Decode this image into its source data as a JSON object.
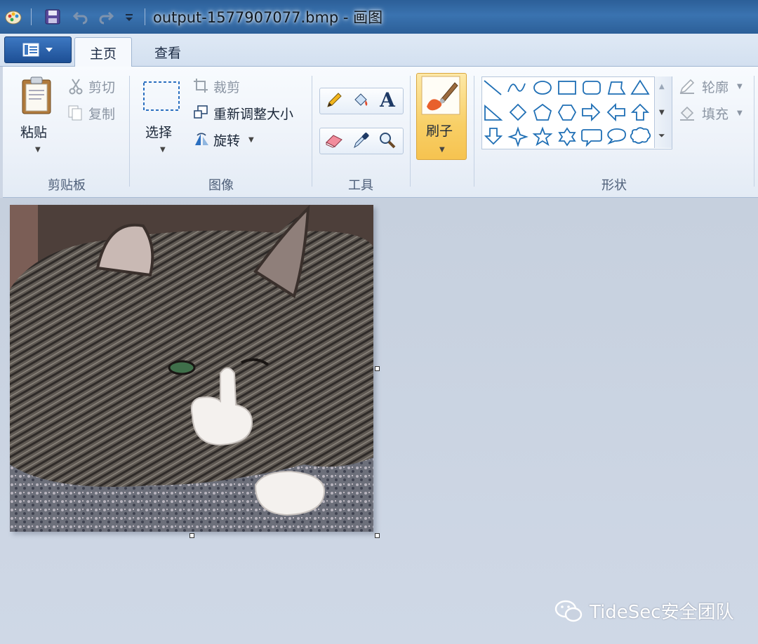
{
  "window": {
    "title": "output-1577907077.bmp - 画图"
  },
  "tabs": [
    "主页",
    "查看"
  ],
  "ribbon": {
    "clipboard": {
      "paste": "粘贴",
      "cut": "剪切",
      "copy": "复制",
      "group": "剪贴板"
    },
    "image": {
      "select": "选择",
      "crop": "裁剪",
      "resize": "重新调整大小",
      "rotate": "旋转",
      "group": "图像"
    },
    "tools": {
      "group": "工具"
    },
    "brush": {
      "label": "刷子"
    },
    "shapes": {
      "outline": "轮廓",
      "fill": "填充",
      "group": "形状"
    }
  },
  "watermark": {
    "text": "TideSec安全团队"
  },
  "colors": {
    "title_bar": "#2c5f98",
    "ribbon_bg": "#edf2f9",
    "workspace_bg": "#cdd6e4",
    "brush_active": "#f8cf66",
    "shape_stroke": "#1f6fb5"
  }
}
